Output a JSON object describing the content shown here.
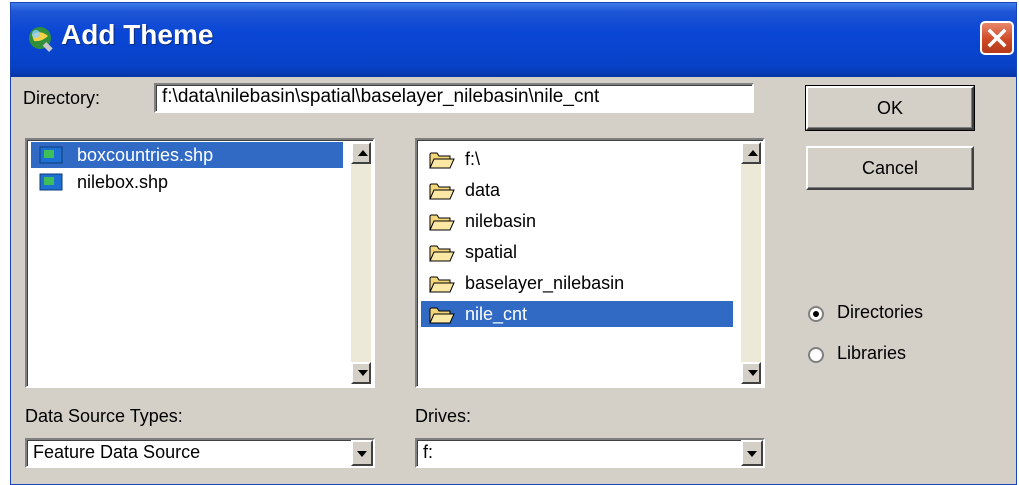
{
  "window": {
    "title": "Add Theme"
  },
  "directory": {
    "label": "Directory:",
    "value": "f:\\data\\nilebasin\\spatial\\baselayer_nilebasin\\nile_cnt"
  },
  "files": [
    {
      "label": "boxcountries.shp",
      "icon": "shapefile-icon",
      "selected": true
    },
    {
      "label": "nilebox.shp",
      "icon": "shapefile-icon",
      "selected": false
    }
  ],
  "folders": [
    {
      "label": "f:\\",
      "icon": "folder-open-icon",
      "selected": false
    },
    {
      "label": "data",
      "icon": "folder-open-icon",
      "selected": false
    },
    {
      "label": "nilebasin",
      "icon": "folder-open-icon",
      "selected": false
    },
    {
      "label": "spatial",
      "icon": "folder-open-icon",
      "selected": false
    },
    {
      "label": "baselayer_nilebasin",
      "icon": "folder-open-icon",
      "selected": false
    },
    {
      "label": "nile_cnt",
      "icon": "folder-open-icon",
      "selected": true
    }
  ],
  "buttons": {
    "ok": "OK",
    "cancel": "Cancel"
  },
  "radio": {
    "directories": {
      "label": "Directories",
      "checked": true
    },
    "libraries": {
      "label": "Libraries",
      "checked": false
    }
  },
  "data_source_types": {
    "label": "Data Source Types:",
    "value": "Feature Data Source"
  },
  "drives": {
    "label": "Drives:",
    "value": "f:"
  },
  "colors": {
    "titlebar": "#0a46d6",
    "selection": "#316ac5",
    "dialog_bg": "#d4d0c8",
    "close_button": "#cf4a26"
  }
}
